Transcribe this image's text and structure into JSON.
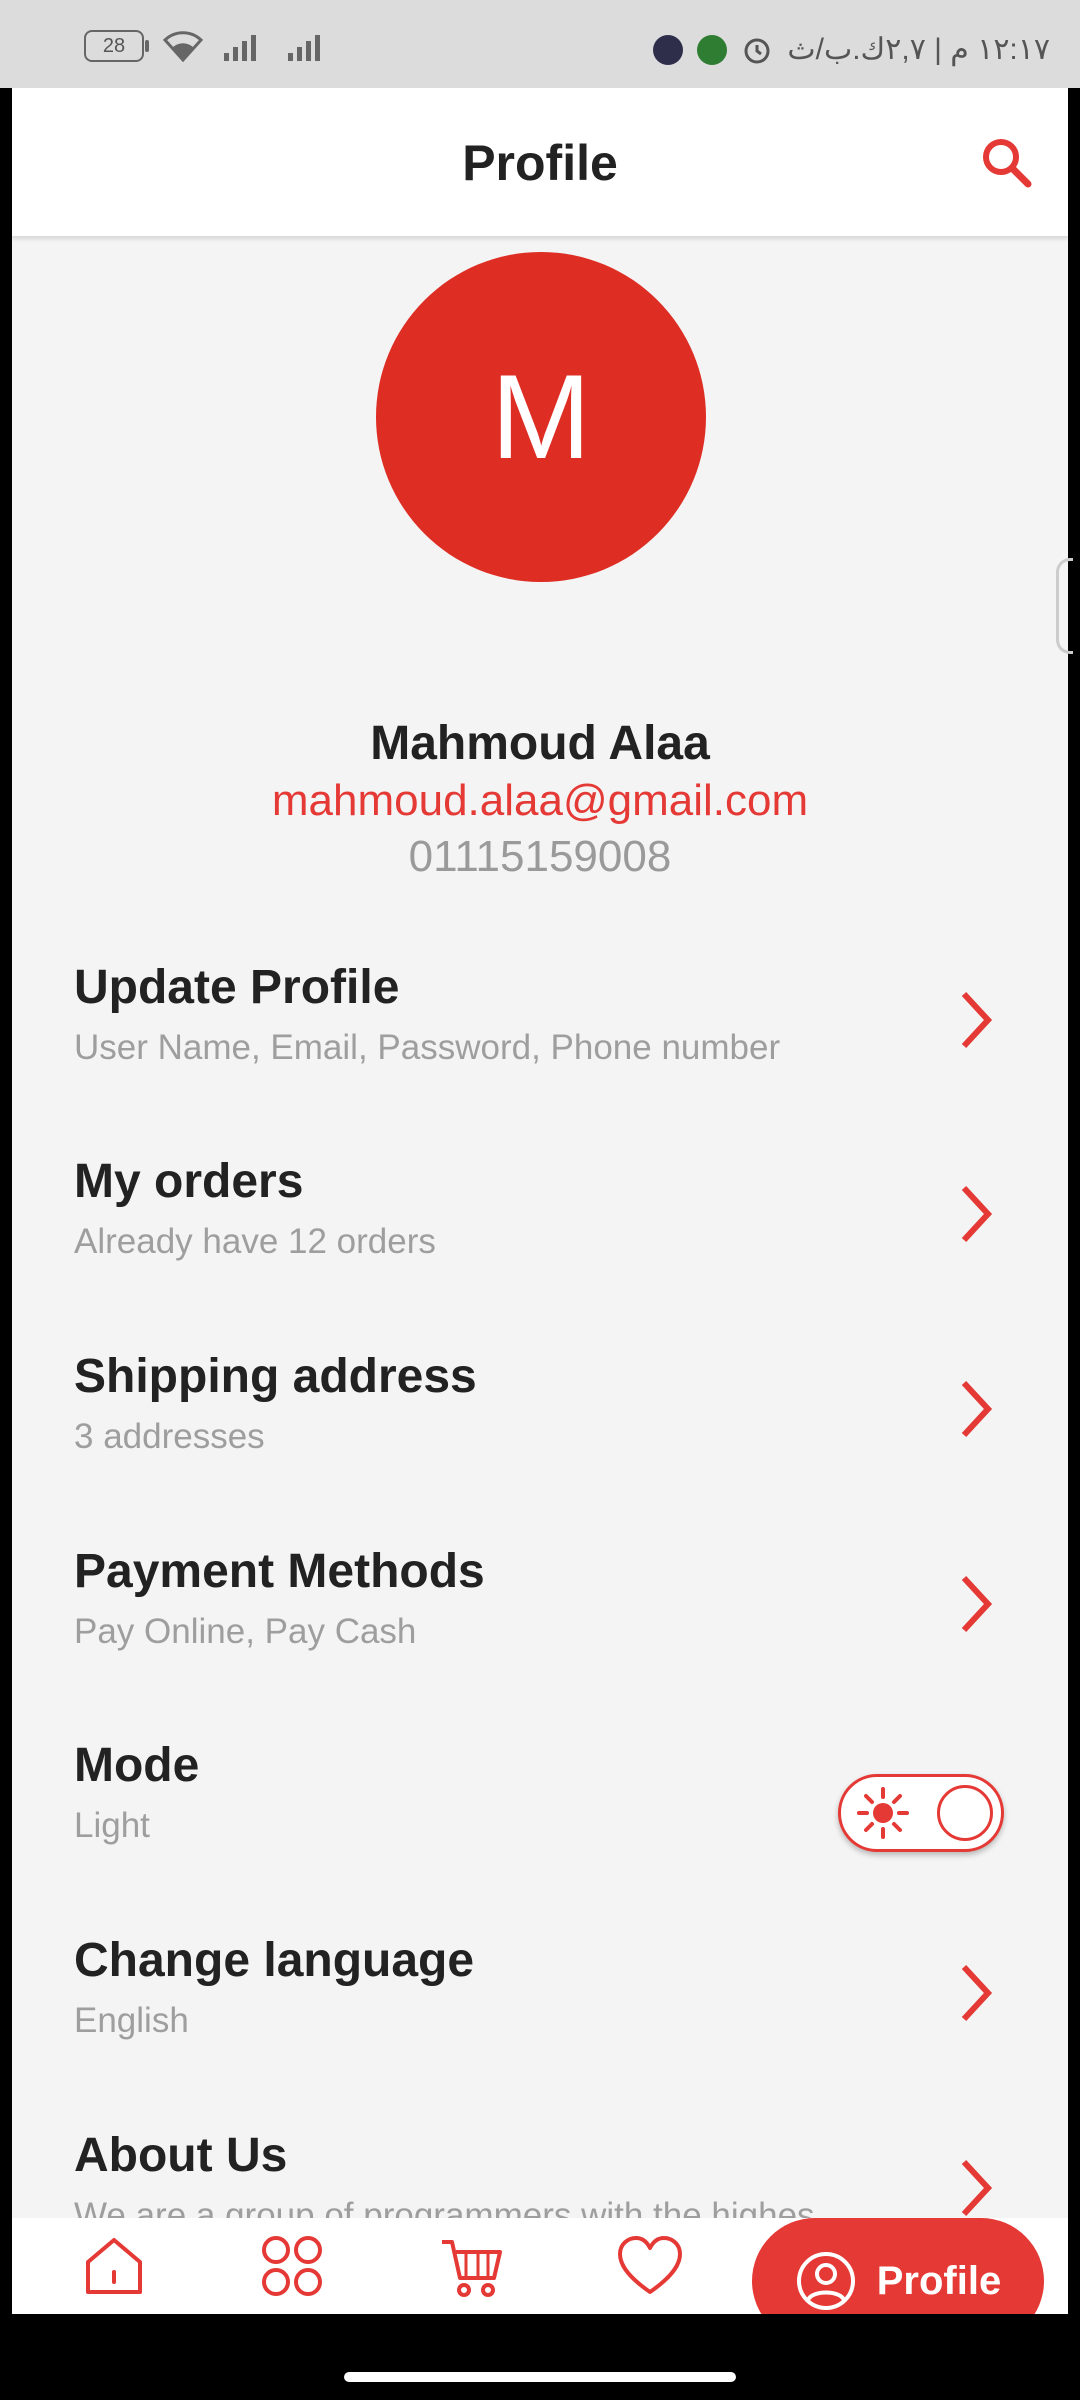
{
  "status_bar": {
    "battery": "28",
    "time_text": "١٢:١٧ م | ٢,٧ك.ب/ث"
  },
  "header": {
    "title": "Profile"
  },
  "icons": {
    "search": "search-icon",
    "home": "home-icon",
    "grid": "grid-icon",
    "cart": "cart-icon",
    "heart": "heart-icon",
    "profile": "profile-icon"
  },
  "colors": {
    "accent": "#e53935",
    "avatar": "#de2d23",
    "background": "#f4f4f4"
  },
  "user": {
    "avatar_initial": "M",
    "name": "Mahmoud Alaa",
    "email": "mahmoud.alaa@gmail.com",
    "phone": "01115159008"
  },
  "menu": [
    {
      "title": "Update Profile",
      "subtitle": "User Name, Email, Password, Phone number"
    },
    {
      "title": "My orders",
      "subtitle": "Already have 12 orders"
    },
    {
      "title": "Shipping address",
      "subtitle": "3 addresses"
    },
    {
      "title": "Payment Methods",
      "subtitle": "Pay Online, Pay Cash"
    },
    {
      "title": "Mode",
      "subtitle": "Light",
      "toggle_on": true
    },
    {
      "title": "Change language",
      "subtitle": "English"
    },
    {
      "title": "About Us",
      "subtitle": "We are a group of programmers with the highes"
    }
  ],
  "bottom_nav": {
    "active_label": "Profile"
  }
}
